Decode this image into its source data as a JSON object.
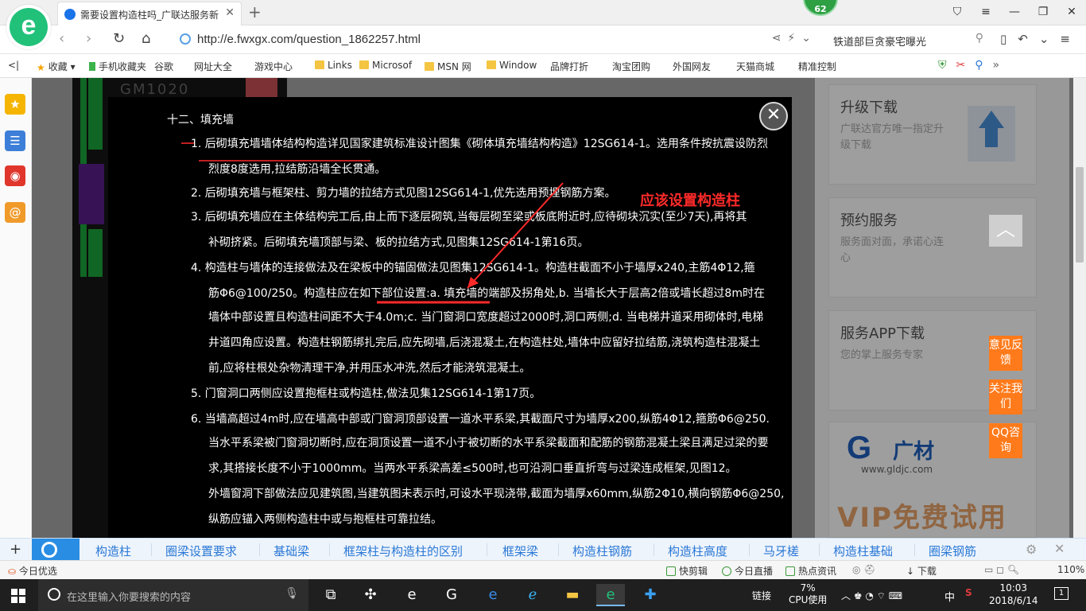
{
  "browser": {
    "tab_title": "需要设置构造柱吗_广联达服务新",
    "badge": "62",
    "url": "http://e.fwxgx.com/question_1862257.html",
    "search_query": "铁道部巨贪豪宅曝光",
    "bookmarks": [
      "收藏",
      "手机收藏夹",
      "谷歌",
      "网址大全",
      "游戏中心",
      "Links",
      "Microsof",
      "MSN 网",
      "Window",
      "品牌打折",
      "淘宝团购",
      "外国网友",
      "天猫商城",
      "精准控制"
    ]
  },
  "modal": {
    "annotation": "应该设置构造柱",
    "lines": [
      "十二、填充墙",
      "1. 后砌填充墙墙体结构构造详见国家建筑标准设计图集《砌体填充墙结构构造》12SG614-1。选用条件按抗震设防烈",
      "烈度8度选用,拉结筋沿墙全长贯通。",
      "2. 后砌填充墙与框架柱、剪力墙的拉结方式见图12SG614-1,优先选用预埋钢筋方案。",
      "3. 后砌填充墙应在主体结构完工后,由上而下逐层砌筑,当每层砌至梁或板底附近时,应待砌块沉实(至少7天),再将其",
      "补砌挤紧。后砌填充墙顶部与梁、板的拉结方式,见图集12SG614-1第16页。",
      "4. 构造柱与墙体的连接做法及在梁板中的锚固做法见图集12SG614-1。构造柱截面不小于墙厚x240,主筋4Φ12,箍",
      "筋Φ6@100/250。构造柱应在如下部位设置:a. 填充墙的端部及拐角处,b. 当墙长大于层高2倍或墙长超过8m时在",
      "墙体中部设置且构造柱间距不大于4.0m;c. 当门窗洞口宽度超过2000时,洞口两侧;d. 当电梯井道采用砌体时,电梯",
      "井道四角应设置。构造柱钢筋绑扎完后,应先砌墙,后浇混凝土,在构造柱处,墙体中应留好拉结筋,浇筑构造柱混凝土",
      "前,应将柱根处杂物清理干净,并用压水冲洗,然后才能浇筑混凝土。",
      "5. 门窗洞口两侧应设置抱框柱或构造柱,做法见集12SG614-1第17页。",
      "6. 当墙高超过4m时,应在墙高中部或门窗洞顶部设置一道水平系梁,其截面尺寸为墙厚x200,纵筋4Φ12,箍筋Φ6@250.",
      "当水平系梁被门窗洞切断时,应在洞顶设置一道不小于被切断的水平系梁截面和配筋的钢筋混凝土梁且满足过梁的要",
      "求,其搭接长度不小于1000mm。当两水平系梁高差≤500时,也可沿洞口垂直折弯与过梁连成框架,见图12。",
      "外墙窗洞下部做法应见建筑图,当建筑图未表示时,可设水平现浇带,截面为墙厚x60mm,纵筋2Φ10,横向钢筋Φ6@250,",
      "纵筋应锚入两侧构造柱中或与抱框柱可靠拉结。"
    ],
    "bg_text": "GM1020"
  },
  "right_panel": {
    "cards": [
      {
        "title": "升级下载",
        "desc": "广联达官方唯一指定升级下载"
      },
      {
        "title": "预约服务",
        "desc": "服务面对面，承诺心连心"
      },
      {
        "title": "服务APP下载",
        "desc": "您的掌上服务专家"
      }
    ],
    "ad_brand": "广材",
    "ad_url": "www.gldjc.com",
    "ad_text": "VIP免费试用",
    "float_buttons": [
      "意见反馈",
      "关注我们",
      "QQ咨询"
    ]
  },
  "keywords": [
    "构造柱",
    "圈梁设置要求",
    "基础梁",
    "框架柱与构造柱的区别",
    "框架梁",
    "构造柱钢筋",
    "构造柱高度",
    "马牙槎",
    "构造柱基础",
    "圈梁钢筋"
  ],
  "status": {
    "left": "今日优选",
    "items": [
      "快剪辑",
      "今日直播",
      "热点资讯"
    ],
    "download": "下载",
    "zoom": "110%"
  },
  "taskbar": {
    "search_placeholder": "在这里输入你要搜索的内容",
    "link_label": "链接",
    "cpu_value": "7%",
    "cpu_label": "CPU使用",
    "ime": "中",
    "time": "10:03",
    "date": "2018/6/14",
    "notifications": "1"
  },
  "colors": {
    "brand_green": "#21c17a",
    "annotation_red": "#ff2a2a",
    "keyword_blue": "#2a78d6",
    "float_orange": "#ff7a1a"
  }
}
